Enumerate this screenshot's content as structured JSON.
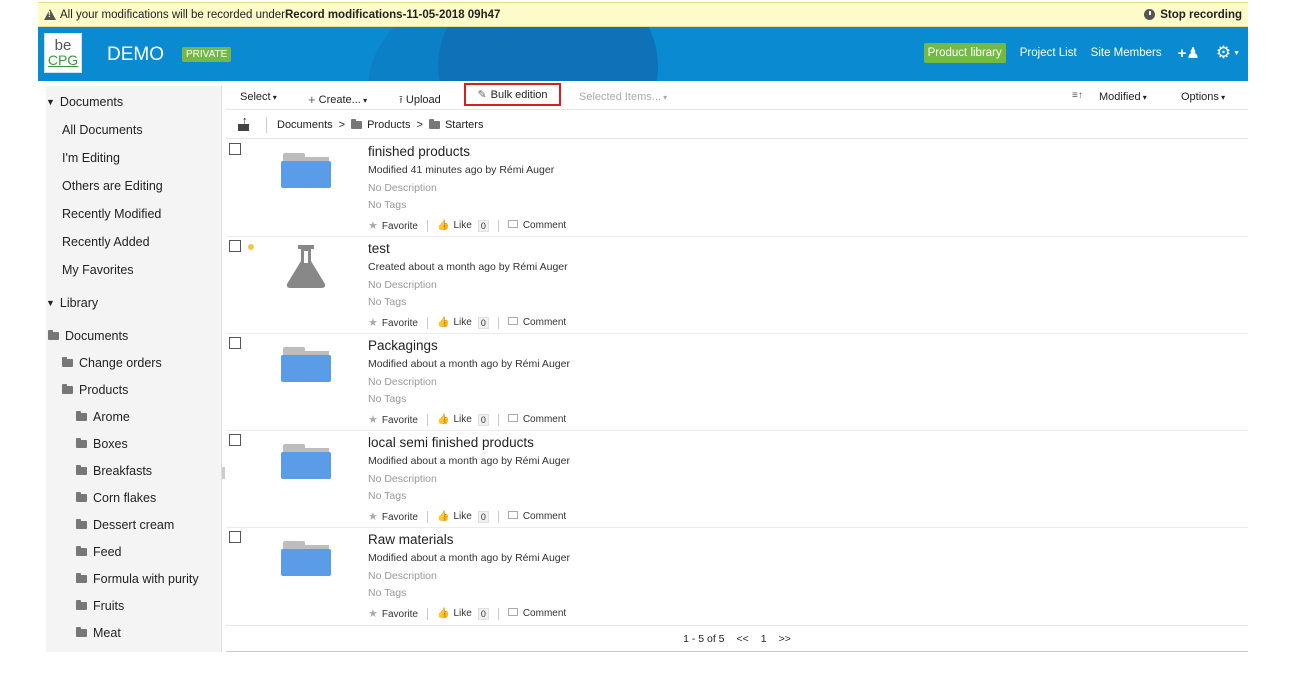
{
  "recording": {
    "message_prefix": "All your modifications will be recorded under",
    "record_name": "Record modifications-11-05-2018 09h47",
    "stop_label": "Stop recording"
  },
  "header": {
    "logo_top": "be",
    "logo_bottom": "CPG",
    "site_name": "DEMO",
    "visibility_badge": "PRIVATE",
    "nav": {
      "product_library": "Product library",
      "project_list": "Project List",
      "site_members": "Site Members"
    }
  },
  "sidebar": {
    "documents_header": "Documents",
    "filters": [
      "All Documents",
      "I'm Editing",
      "Others are Editing",
      "Recently Modified",
      "Recently Added",
      "My Favorites"
    ],
    "library_header": "Library",
    "tree_root": "Documents",
    "tree_level1": [
      "Change orders",
      "Products"
    ],
    "tree_level2": [
      "Arome",
      "Boxes",
      "Breakfasts",
      "Corn flakes",
      "Dessert cream",
      "Feed",
      "Formula with purity",
      "Fruits",
      "Meat"
    ]
  },
  "toolbar": {
    "select": "Select",
    "create": "Create...",
    "upload": "Upload",
    "bulk_edition": "Bulk edition",
    "selected_items": "Selected Items...",
    "sort_by": "Modified",
    "options": "Options"
  },
  "breadcrumb": [
    "Documents",
    "Products",
    "Starters"
  ],
  "items": [
    {
      "title": "finished products",
      "meta": "Modified 41 minutes ago by Rémi Auger",
      "description": "No Description",
      "tags": "No Tags",
      "icon": "folder-icon",
      "likes": "0"
    },
    {
      "title": "test",
      "meta": "Created about a month ago by Rémi Auger",
      "description": "No Description",
      "tags": "No Tags",
      "icon": "flask-icon",
      "likes": "0"
    },
    {
      "title": "Packagings",
      "meta": "Modified about a month ago by Rémi Auger",
      "description": "No Description",
      "tags": "No Tags",
      "icon": "folder-icon",
      "likes": "0"
    },
    {
      "title": "local semi finished products",
      "meta": "Modified about a month ago by Rémi Auger",
      "description": "No Description",
      "tags": "No Tags",
      "icon": "folder-icon",
      "likes": "0"
    },
    {
      "title": "Raw materials",
      "meta": "Modified about a month ago by Rémi Auger",
      "description": "No Description",
      "tags": "No Tags",
      "icon": "folder-icon",
      "likes": "0"
    }
  ],
  "actions": {
    "favorite": "Favorite",
    "like": "Like",
    "comment": "Comment"
  },
  "pager": {
    "range": "1 - 5 of 5",
    "prev": "<<",
    "page": "1",
    "next": ">>"
  },
  "colors": {
    "header_blue": "#0a8bd1",
    "accent_green": "#74b944",
    "folder_blue": "#5a9ce8",
    "highlight_red": "#d62020"
  }
}
